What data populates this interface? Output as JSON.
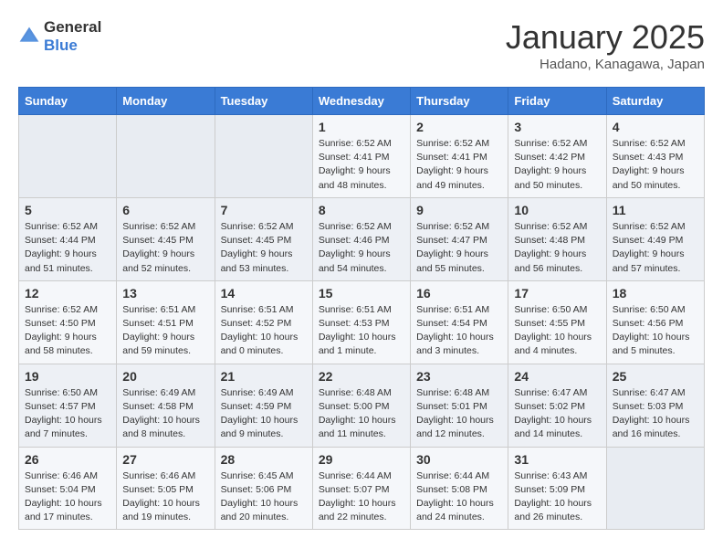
{
  "logo": {
    "general": "General",
    "blue": "Blue"
  },
  "title": "January 2025",
  "subtitle": "Hadano, Kanagawa, Japan",
  "days_of_week": [
    "Sunday",
    "Monday",
    "Tuesday",
    "Wednesday",
    "Thursday",
    "Friday",
    "Saturday"
  ],
  "weeks": [
    [
      {
        "day": "",
        "info": ""
      },
      {
        "day": "",
        "info": ""
      },
      {
        "day": "",
        "info": ""
      },
      {
        "day": "1",
        "info": "Sunrise: 6:52 AM\nSunset: 4:41 PM\nDaylight: 9 hours\nand 48 minutes."
      },
      {
        "day": "2",
        "info": "Sunrise: 6:52 AM\nSunset: 4:41 PM\nDaylight: 9 hours\nand 49 minutes."
      },
      {
        "day": "3",
        "info": "Sunrise: 6:52 AM\nSunset: 4:42 PM\nDaylight: 9 hours\nand 50 minutes."
      },
      {
        "day": "4",
        "info": "Sunrise: 6:52 AM\nSunset: 4:43 PM\nDaylight: 9 hours\nand 50 minutes."
      }
    ],
    [
      {
        "day": "5",
        "info": "Sunrise: 6:52 AM\nSunset: 4:44 PM\nDaylight: 9 hours\nand 51 minutes."
      },
      {
        "day": "6",
        "info": "Sunrise: 6:52 AM\nSunset: 4:45 PM\nDaylight: 9 hours\nand 52 minutes."
      },
      {
        "day": "7",
        "info": "Sunrise: 6:52 AM\nSunset: 4:45 PM\nDaylight: 9 hours\nand 53 minutes."
      },
      {
        "day": "8",
        "info": "Sunrise: 6:52 AM\nSunset: 4:46 PM\nDaylight: 9 hours\nand 54 minutes."
      },
      {
        "day": "9",
        "info": "Sunrise: 6:52 AM\nSunset: 4:47 PM\nDaylight: 9 hours\nand 55 minutes."
      },
      {
        "day": "10",
        "info": "Sunrise: 6:52 AM\nSunset: 4:48 PM\nDaylight: 9 hours\nand 56 minutes."
      },
      {
        "day": "11",
        "info": "Sunrise: 6:52 AM\nSunset: 4:49 PM\nDaylight: 9 hours\nand 57 minutes."
      }
    ],
    [
      {
        "day": "12",
        "info": "Sunrise: 6:52 AM\nSunset: 4:50 PM\nDaylight: 9 hours\nand 58 minutes."
      },
      {
        "day": "13",
        "info": "Sunrise: 6:51 AM\nSunset: 4:51 PM\nDaylight: 9 hours\nand 59 minutes."
      },
      {
        "day": "14",
        "info": "Sunrise: 6:51 AM\nSunset: 4:52 PM\nDaylight: 10 hours\nand 0 minutes."
      },
      {
        "day": "15",
        "info": "Sunrise: 6:51 AM\nSunset: 4:53 PM\nDaylight: 10 hours\nand 1 minute."
      },
      {
        "day": "16",
        "info": "Sunrise: 6:51 AM\nSunset: 4:54 PM\nDaylight: 10 hours\nand 3 minutes."
      },
      {
        "day": "17",
        "info": "Sunrise: 6:50 AM\nSunset: 4:55 PM\nDaylight: 10 hours\nand 4 minutes."
      },
      {
        "day": "18",
        "info": "Sunrise: 6:50 AM\nSunset: 4:56 PM\nDaylight: 10 hours\nand 5 minutes."
      }
    ],
    [
      {
        "day": "19",
        "info": "Sunrise: 6:50 AM\nSunset: 4:57 PM\nDaylight: 10 hours\nand 7 minutes."
      },
      {
        "day": "20",
        "info": "Sunrise: 6:49 AM\nSunset: 4:58 PM\nDaylight: 10 hours\nand 8 minutes."
      },
      {
        "day": "21",
        "info": "Sunrise: 6:49 AM\nSunset: 4:59 PM\nDaylight: 10 hours\nand 9 minutes."
      },
      {
        "day": "22",
        "info": "Sunrise: 6:48 AM\nSunset: 5:00 PM\nDaylight: 10 hours\nand 11 minutes."
      },
      {
        "day": "23",
        "info": "Sunrise: 6:48 AM\nSunset: 5:01 PM\nDaylight: 10 hours\nand 12 minutes."
      },
      {
        "day": "24",
        "info": "Sunrise: 6:47 AM\nSunset: 5:02 PM\nDaylight: 10 hours\nand 14 minutes."
      },
      {
        "day": "25",
        "info": "Sunrise: 6:47 AM\nSunset: 5:03 PM\nDaylight: 10 hours\nand 16 minutes."
      }
    ],
    [
      {
        "day": "26",
        "info": "Sunrise: 6:46 AM\nSunset: 5:04 PM\nDaylight: 10 hours\nand 17 minutes."
      },
      {
        "day": "27",
        "info": "Sunrise: 6:46 AM\nSunset: 5:05 PM\nDaylight: 10 hours\nand 19 minutes."
      },
      {
        "day": "28",
        "info": "Sunrise: 6:45 AM\nSunset: 5:06 PM\nDaylight: 10 hours\nand 20 minutes."
      },
      {
        "day": "29",
        "info": "Sunrise: 6:44 AM\nSunset: 5:07 PM\nDaylight: 10 hours\nand 22 minutes."
      },
      {
        "day": "30",
        "info": "Sunrise: 6:44 AM\nSunset: 5:08 PM\nDaylight: 10 hours\nand 24 minutes."
      },
      {
        "day": "31",
        "info": "Sunrise: 6:43 AM\nSunset: 5:09 PM\nDaylight: 10 hours\nand 26 minutes."
      },
      {
        "day": "",
        "info": ""
      }
    ]
  ]
}
